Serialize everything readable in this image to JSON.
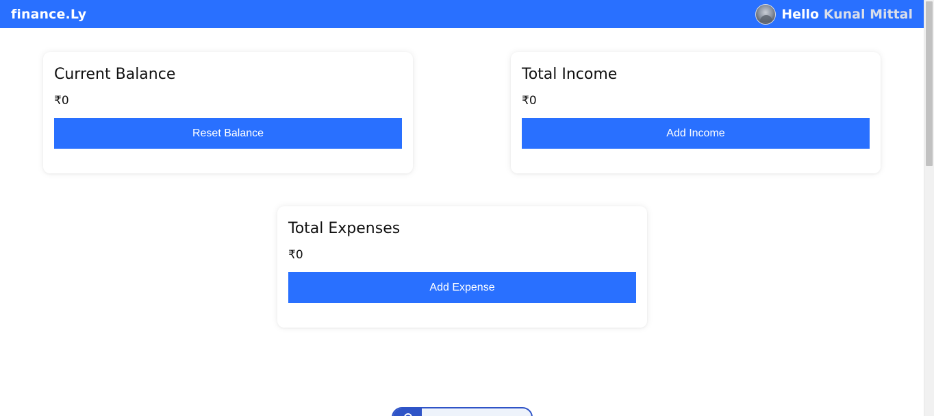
{
  "navbar": {
    "brand": "finance.Ly",
    "greeting_prefix": "Hello",
    "user_name": "Kunal Mittal",
    "avatar_icon": "user-avatar"
  },
  "cards": {
    "balance": {
      "title": "Current Balance",
      "value": "₹0",
      "button_label": "Reset Balance"
    },
    "income": {
      "title": "Total Income",
      "value": "₹0",
      "button_label": "Add Income"
    },
    "expense": {
      "title": "Total Expenses",
      "value": "₹0",
      "button_label": "Add Expense"
    }
  },
  "colors": {
    "accent": "#2970ff",
    "background": "#ffffff",
    "text": "#111111"
  }
}
